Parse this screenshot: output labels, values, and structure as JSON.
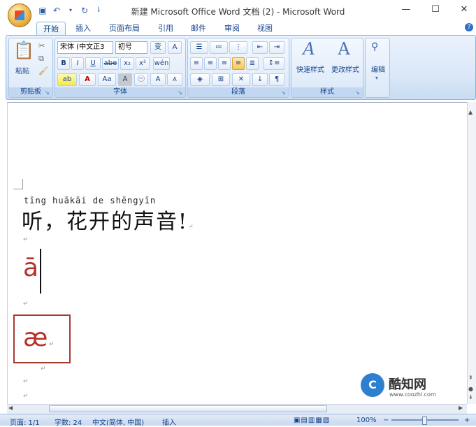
{
  "window": {
    "title": "新建 Microsoft Office Word 文档 (2) - Microsoft Word",
    "controls": {
      "minimize": "—",
      "maximize": "☐",
      "close": "✕"
    }
  },
  "quick_access": [
    "save-icon",
    "undo-icon",
    "redo-icon",
    "customize-icon"
  ],
  "tabs": [
    "开始",
    "插入",
    "页面布局",
    "引用",
    "邮件",
    "审阅",
    "视图"
  ],
  "ribbon": {
    "clipboard": {
      "label": "剪贴板",
      "paste": "粘贴"
    },
    "font": {
      "label": "字体",
      "font_name": "宋体 (中文正3",
      "font_size": "初号",
      "bold": "B",
      "italic": "I",
      "underline": "U",
      "strike": "abe",
      "subscript": "x₂",
      "superscript": "x²",
      "change_case": "Aa",
      "grow": "A",
      "shrink": "A",
      "phonetic": "wén",
      "clear": "A"
    },
    "paragraph": {
      "label": "段落"
    },
    "styles": {
      "label": "样式",
      "quick_styles": "快速样式",
      "change_styles": "更改样式"
    },
    "editing": {
      "label": "编辑"
    }
  },
  "document": {
    "pinyin_line": "tīng   huākāi de shēngyīn",
    "main_line": "听，花开的声音!",
    "char_a": "ā",
    "char_ae": "æ"
  },
  "status": {
    "page": "页面: 1/1",
    "words": "字数: 24",
    "language": "中文(简体, 中国)",
    "mode": "插入",
    "zoom": "100%",
    "minus": "−",
    "plus": "+"
  },
  "watermark": {
    "name": "酷知网",
    "url": "www.coozhi.com"
  },
  "colors": {
    "accent_red": "#b8302a",
    "ribbon_blue": "#dbe8f8",
    "text_blue": "#15428b"
  }
}
